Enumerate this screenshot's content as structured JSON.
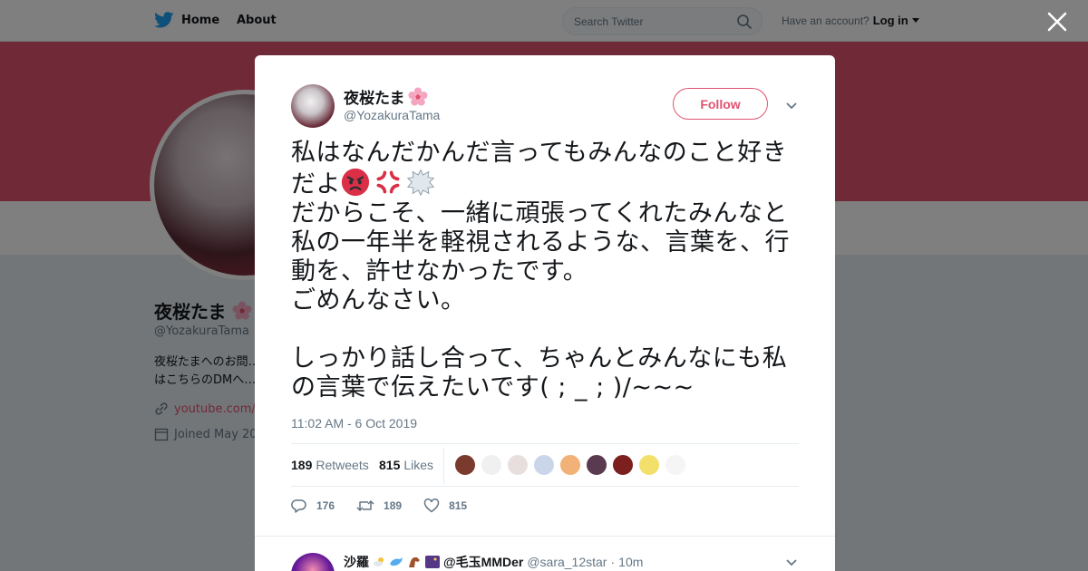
{
  "topbar": {
    "home_label": "Home",
    "about_label": "About",
    "search_placeholder": "Search Twitter",
    "have_account": "Have an account?",
    "login_label": "Log in"
  },
  "profile": {
    "name": "夜桜たま",
    "handle": "@YozakuraTama",
    "bio": "夜桜たまへのお問…はこちらのDMへ…",
    "url": "youtube.com/c…",
    "joined": "Joined May 20…"
  },
  "tweet": {
    "author_name": "夜桜たま",
    "author_handle": "@YozakuraTama",
    "follow_label": "Follow",
    "text_line1": "私はなんだかんだ言ってもみんなのこと好きだよ",
    "text_rest": "だからこそ、一緒に頑張ってくれたみんなと私の一年半を軽視されるような、言葉を、行動を、許せなかったです。\nごめんなさい。\n\nしっかり話し合って、ちゃんとみんなにも私の言葉で伝えたいです( ; _ ; )/~~~",
    "timestamp": "11:02 AM - 6 Oct 2019",
    "retweets_count": "189",
    "retweets_label": "Retweets",
    "likes_count": "815",
    "likes_label": "Likes",
    "reply_count": "176",
    "retweet_action_count": "189",
    "like_action_count": "815",
    "emoji_icons": [
      "angry-face-icon",
      "anger-symbol-icon",
      "speech-balloon-icon"
    ]
  },
  "reply": {
    "name": "沙羅",
    "handle": "@sara_12star",
    "mention": "@毛玉MMDer",
    "time": "10m"
  },
  "colors": {
    "accent": "#e0526f",
    "secondary_text": "#657786",
    "twitter_blue": "#1da1f2"
  }
}
